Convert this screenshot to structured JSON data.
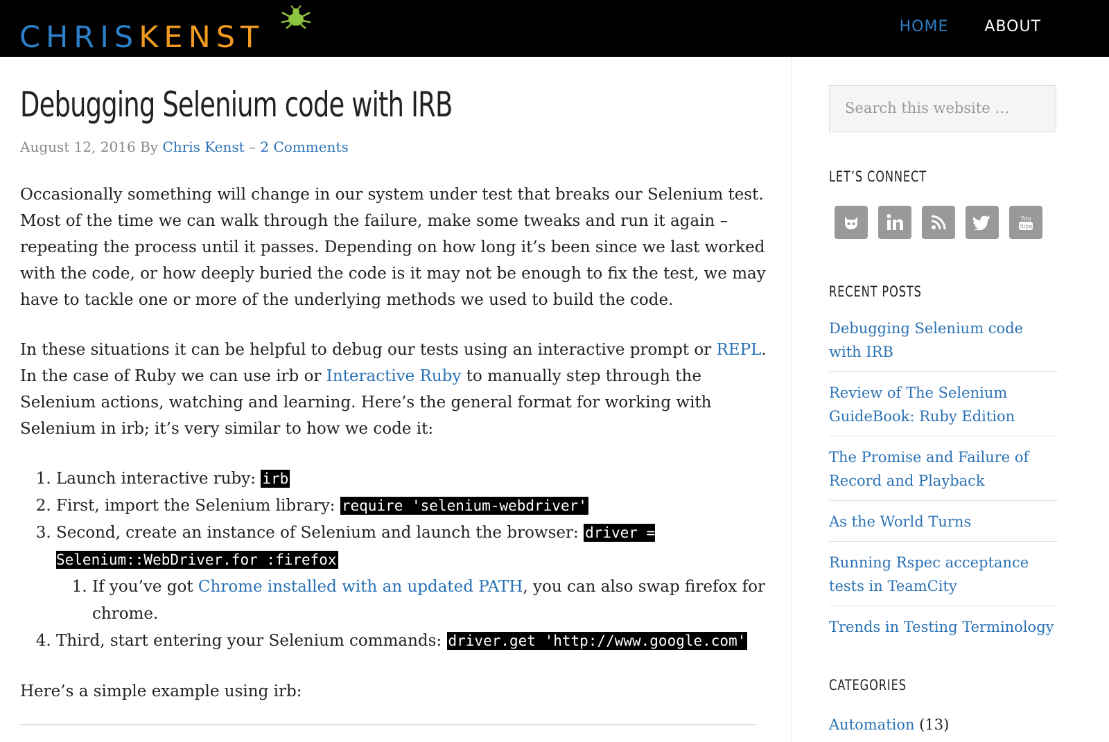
{
  "header": {
    "logo_part1": "CHRIS",
    "logo_part2": "KENST",
    "nav": {
      "home": "HOME",
      "about": "ABOUT"
    }
  },
  "article": {
    "title": "Debugging Selenium code with IRB",
    "date": "August 12, 2016",
    "by": " By ",
    "author": "Chris Kenst",
    "sep": " – ",
    "comments": "2 Comments",
    "p1": "Occasionally something will change in our system under test that breaks our Selenium test. Most of the time we can walk through the failure, make some tweaks and run it again – repeating the process until it passes. Depending on how long it’s been since we last worked with the code, or how deeply buried the code is it may not be enough to fix the test, we may have to tackle one or more of the underlying methods we used to build the code.",
    "p2_a": "In these situations it can be helpful to debug our tests using an interactive prompt or ",
    "p2_link1": "REPL",
    "p2_b": ". In the case of Ruby we can use irb or ",
    "p2_link2": "Interactive Ruby",
    "p2_c": " to manually step through the Selenium actions, watching and learning. Here’s the general format for working with Selenium in irb; it’s very similar to how we code it:",
    "steps": {
      "s1_text": "Launch interactive ruby: ",
      "s1_code": "irb",
      "s2_text": "First, import the Selenium library: ",
      "s2_code": "require 'selenium-webdriver'",
      "s3_text": "Second, create an instance of Selenium and launch the browser: ",
      "s3_code": "driver = Selenium::WebDriver.for :firefox",
      "s3_sub_a": "If you’ve got ",
      "s3_sub_link": "Chrome installed with an updated PATH",
      "s3_sub_b": ", you can also swap firefox for chrome.",
      "s4_text": "Third, start entering your Selenium commands: ",
      "s4_code": "driver.get 'http://www.google.com'"
    },
    "tail": "Here’s a simple example using irb:"
  },
  "sidebar": {
    "search_placeholder": "Search this website …",
    "connect_title": "LET’S CONNECT",
    "recent_title": "RECENT POSTS",
    "recent_posts": [
      "Debugging Selenium code with IRB",
      "Review of The Selenium GuideBook: Ruby Edition",
      "The Promise and Failure of Record and Playback",
      "As the World Turns",
      "Running Rspec acceptance tests in TeamCity",
      "Trends in Testing Terminology"
    ],
    "categories_title": "CATEGORIES",
    "categories": [
      {
        "name": "Automation",
        "count": "(13)"
      }
    ]
  },
  "colors": {
    "link": "#2a72b5",
    "logo_blue": "#2c7fc8",
    "logo_orange": "#f29a1f",
    "bug_green": "#8cc63f",
    "header_bg": "#000000",
    "social_gray": "#999999"
  },
  "icons": [
    "bug-logo-icon",
    "github-icon",
    "linkedin-icon",
    "rss-icon",
    "twitter-icon",
    "youtube-icon"
  ]
}
